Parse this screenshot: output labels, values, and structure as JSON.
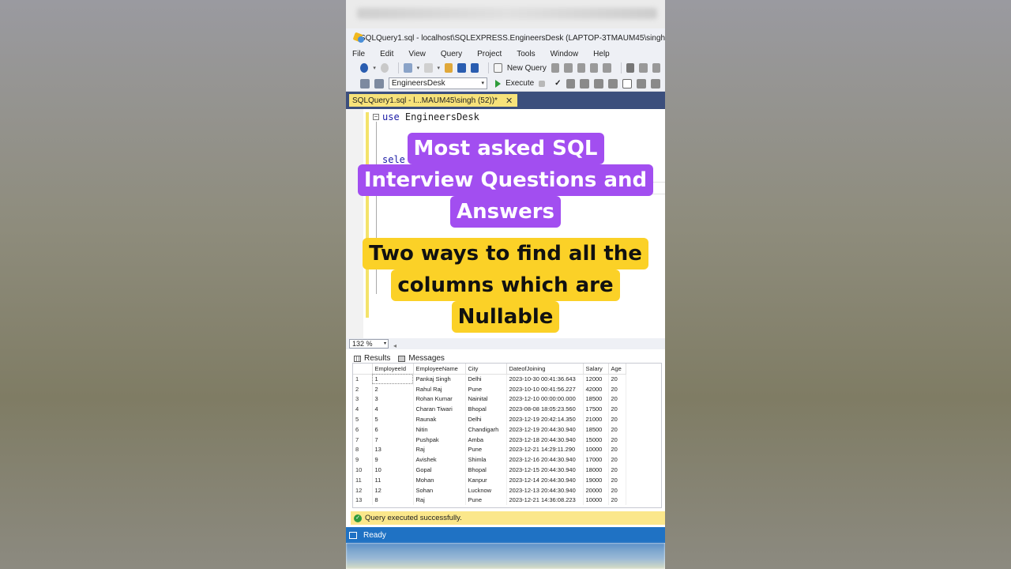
{
  "window": {
    "title": "SQLQuery1.sql - localhost\\SQLEXPRESS.EngineersDesk (LAPTOP-3TMAUM45\\singh (52))"
  },
  "menu": [
    "File",
    "Edit",
    "View",
    "Query",
    "Project",
    "Tools",
    "Window",
    "Help"
  ],
  "toolbar": {
    "new_query_label": "New Query",
    "database": "EngineersDesk",
    "execute_label": "Execute"
  },
  "tab": {
    "label": "SQLQuery1.sql - l...MAUM45\\singh (52))*",
    "close": "✕"
  },
  "editor": {
    "line1_keyword": "use",
    "line1_rest": "EngineersDesk",
    "line2_partial": "sele"
  },
  "overlay": {
    "title_lines": [
      "Most asked SQL",
      "Interview Questions and",
      "Answers"
    ],
    "subtitle_lines": [
      "Two ways to find all the",
      "columns which are",
      "Nullable"
    ]
  },
  "zoom": "132 %",
  "result_tabs": {
    "results": "Results",
    "messages": "Messages"
  },
  "results": {
    "columns": [
      "EmployeeId",
      "EmployeeName",
      "City",
      "DateofJoining",
      "Salary",
      "Age"
    ],
    "rows": [
      [
        "1",
        "1",
        "Pankaj Singh",
        "Delhi",
        "2023-10-30 00:41:36.643",
        "12000",
        "20"
      ],
      [
        "2",
        "2",
        "Rahul Raj",
        "Pune",
        "2023-10-10 00:41:56.227",
        "42000",
        "20"
      ],
      [
        "3",
        "3",
        "Rohan Kumar",
        "Nainital",
        "2023-12-10 00:00:00.000",
        "18500",
        "20"
      ],
      [
        "4",
        "4",
        "Charan Tiwari",
        "Bhopal",
        "2023-08-08 18:05:23.560",
        "17500",
        "20"
      ],
      [
        "5",
        "5",
        "Raunak",
        "Delhi",
        "2023-12-19 20:42:14.350",
        "21000",
        "20"
      ],
      [
        "6",
        "6",
        "Nitin",
        "Chandigarh",
        "2023-12-19 20:44:30.940",
        "18500",
        "20"
      ],
      [
        "7",
        "7",
        "Pushpak",
        "Amba",
        "2023-12-18 20:44:30.940",
        "15000",
        "20"
      ],
      [
        "8",
        "13",
        "Raj",
        "Pune",
        "2023-12-21 14:29:11.290",
        "10000",
        "20"
      ],
      [
        "9",
        "9",
        "Avishek",
        "Shimla",
        "2023-12-16 20:44:30.940",
        "17000",
        "20"
      ],
      [
        "10",
        "10",
        "Gopal",
        "Bhopal",
        "2023-12-15 20:44:30.940",
        "18000",
        "20"
      ],
      [
        "11",
        "11",
        "Mohan",
        "Kanpur",
        "2023-12-14 20:44:30.940",
        "19000",
        "20"
      ],
      [
        "12",
        "12",
        "Sohan",
        "Lucknow",
        "2023-12-13 20:44:30.940",
        "20000",
        "20"
      ],
      [
        "13",
        "8",
        "Raj",
        "Pune",
        "2023-12-21 14:36:08.223",
        "10000",
        "20"
      ]
    ]
  },
  "status": {
    "message": "Query executed successfully.",
    "ready": "Ready"
  },
  "colors": {
    "purple_pill": "#a24ef0",
    "yellow_pill": "#fbd127",
    "tab_active": "#f7e27a",
    "status_bar": "#1f72c4",
    "success": "#2f9b3c"
  }
}
